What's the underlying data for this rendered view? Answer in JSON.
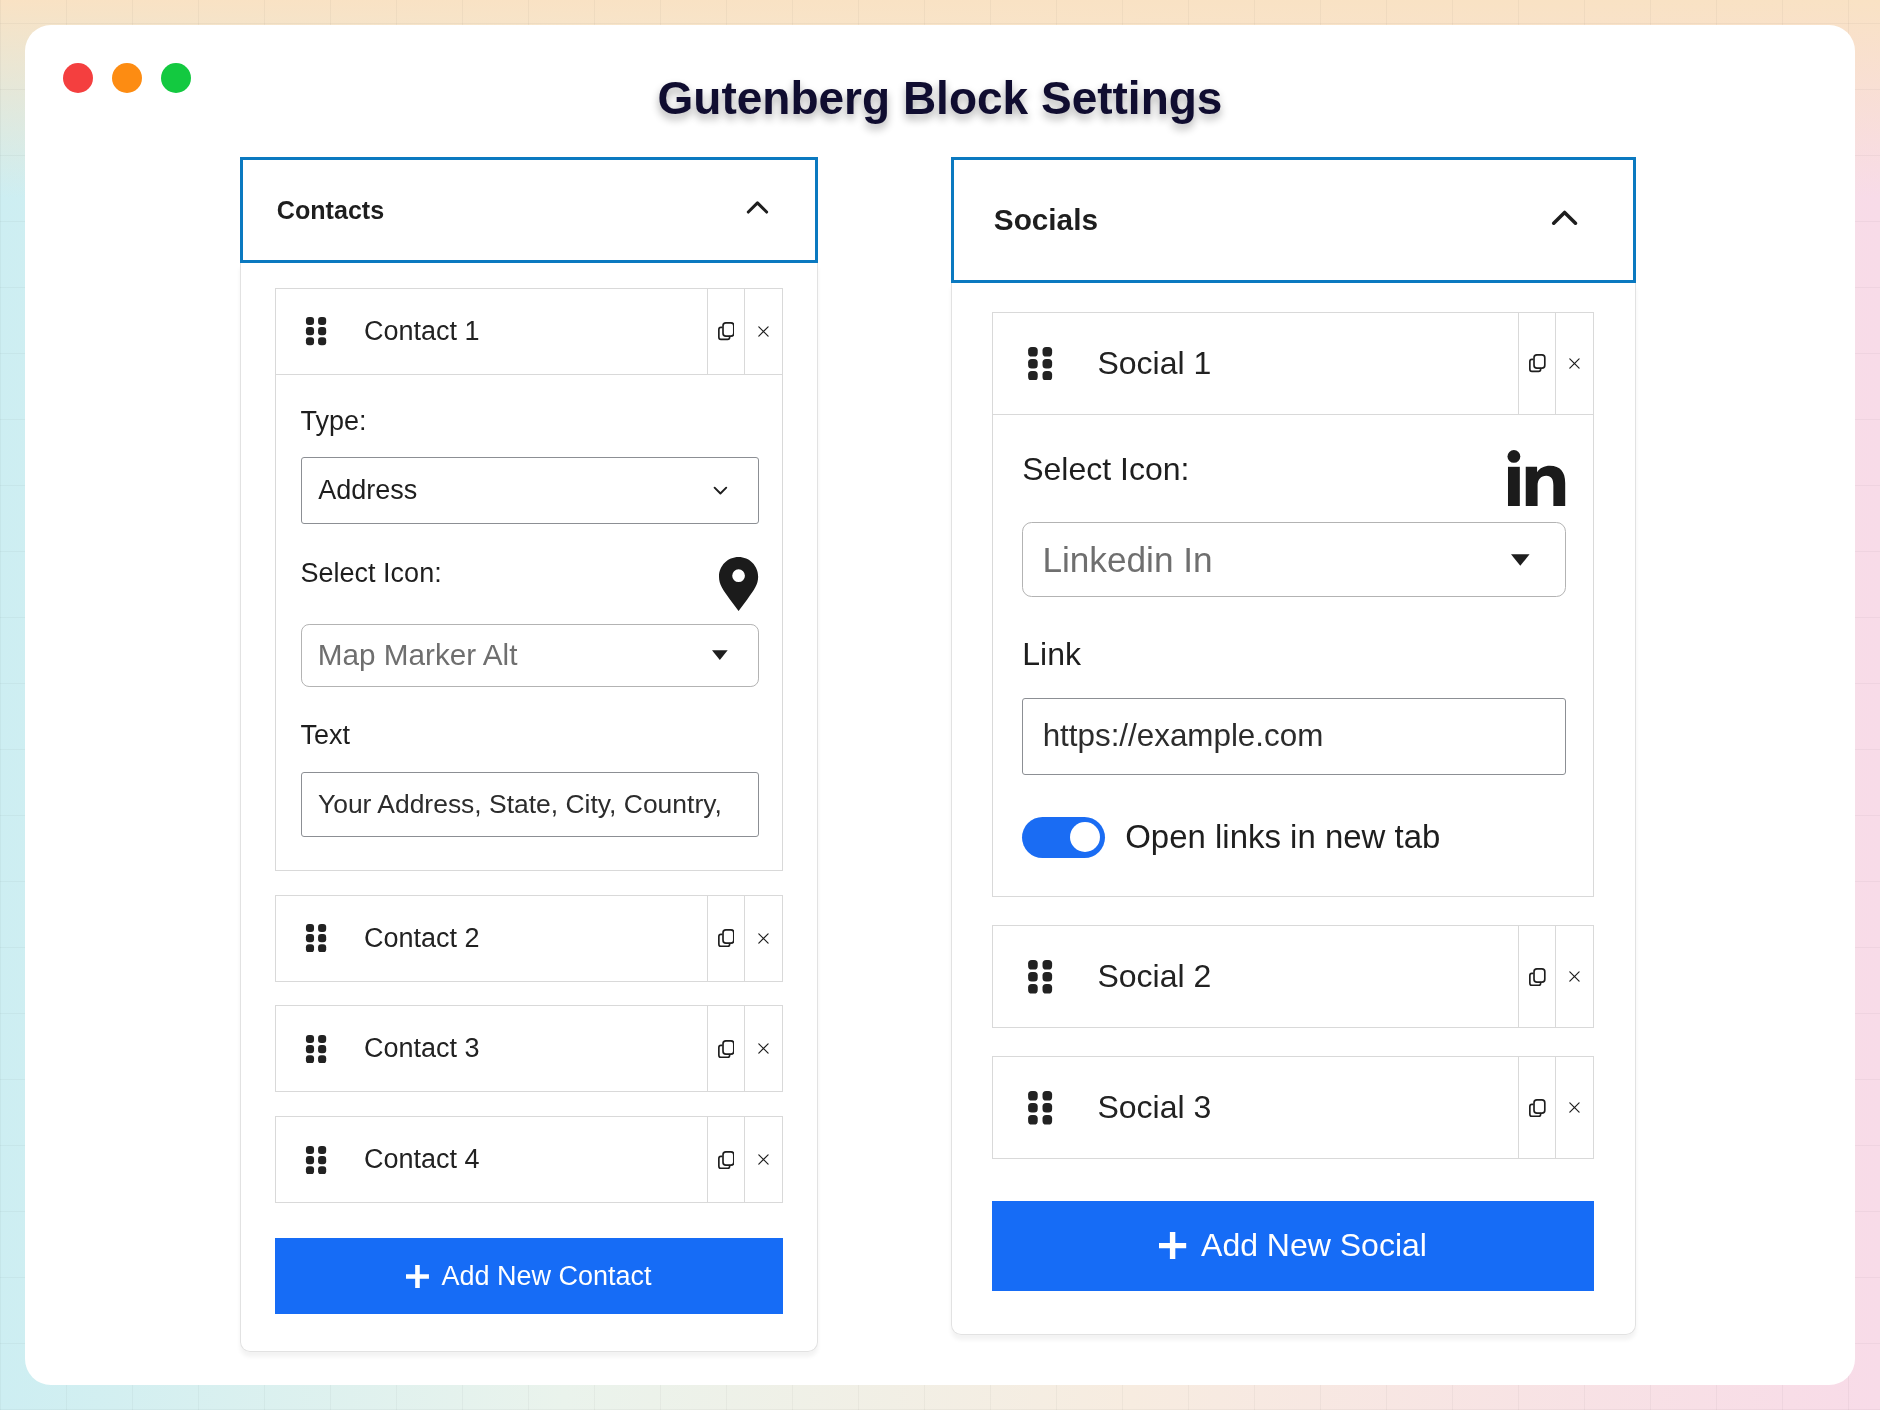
{
  "window": {
    "controls": [
      {
        "color": "#f43f3f"
      },
      {
        "color": "#fd8c12"
      },
      {
        "color": "#13c940"
      }
    ],
    "title": "Gutenberg Block Settings"
  },
  "panels": [
    {
      "kind": "contacts",
      "title": "Contacts",
      "expanded": true,
      "items": [
        {
          "label": "Contact 1",
          "expanded": true,
          "fields": [
            {
              "kind": "dropdown",
              "label": "Type:",
              "value": "Address"
            },
            {
              "kind": "icon_select",
              "label": "Select Icon:",
              "value": "Map Marker Alt"
            },
            {
              "kind": "text",
              "label": "Text",
              "value": "Your Address, State, City, Country,"
            }
          ]
        },
        {
          "label": "Contact 2",
          "expanded": false
        },
        {
          "label": "Contact 3",
          "expanded": false
        },
        {
          "label": "Contact 4",
          "expanded": false
        }
      ],
      "add_button": "Add New Contact"
    },
    {
      "kind": "socials",
      "title": "Socials",
      "expanded": true,
      "items": [
        {
          "label": "Social 1",
          "expanded": true,
          "fields": [
            {
              "kind": "icon_select",
              "label": "Select Icon:",
              "value": "Linkedin In"
            },
            {
              "kind": "text",
              "label": "Link",
              "value": "https://example.com"
            },
            {
              "kind": "toggle",
              "label": "Open links in new tab",
              "on": true
            }
          ]
        },
        {
          "label": "Social 2",
          "expanded": false
        },
        {
          "label": "Social 3",
          "expanded": false
        }
      ],
      "add_button": "Add New Social"
    }
  ]
}
